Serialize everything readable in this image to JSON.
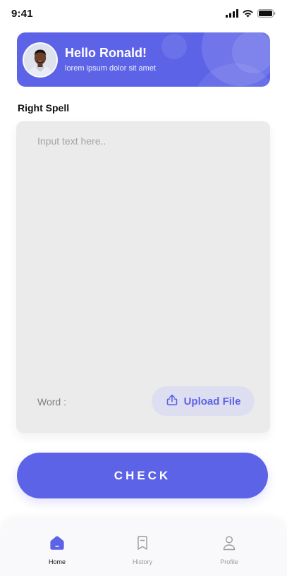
{
  "status_bar": {
    "time": "9:41",
    "icons": [
      "cellular-signal-icon",
      "wifi-icon",
      "battery-icon"
    ]
  },
  "header": {
    "greeting": "Hello Ronald!",
    "subtitle": "lorem ipsum dolor sit amet",
    "accent_color": "#5d63e7"
  },
  "section": {
    "title": "Right Spell"
  },
  "editor": {
    "placeholder": "Input text here..",
    "value": "",
    "word_label": "Word :",
    "upload_label": "Upload File",
    "upload_icon": "upload-icon"
  },
  "check_button": {
    "label": "CHECK"
  },
  "bottom_nav": {
    "items": [
      {
        "label": "Home",
        "icon": "home-icon",
        "active": true
      },
      {
        "label": "History",
        "icon": "bookmark-icon",
        "active": false
      },
      {
        "label": "Profile",
        "icon": "user-icon",
        "active": false
      }
    ]
  }
}
